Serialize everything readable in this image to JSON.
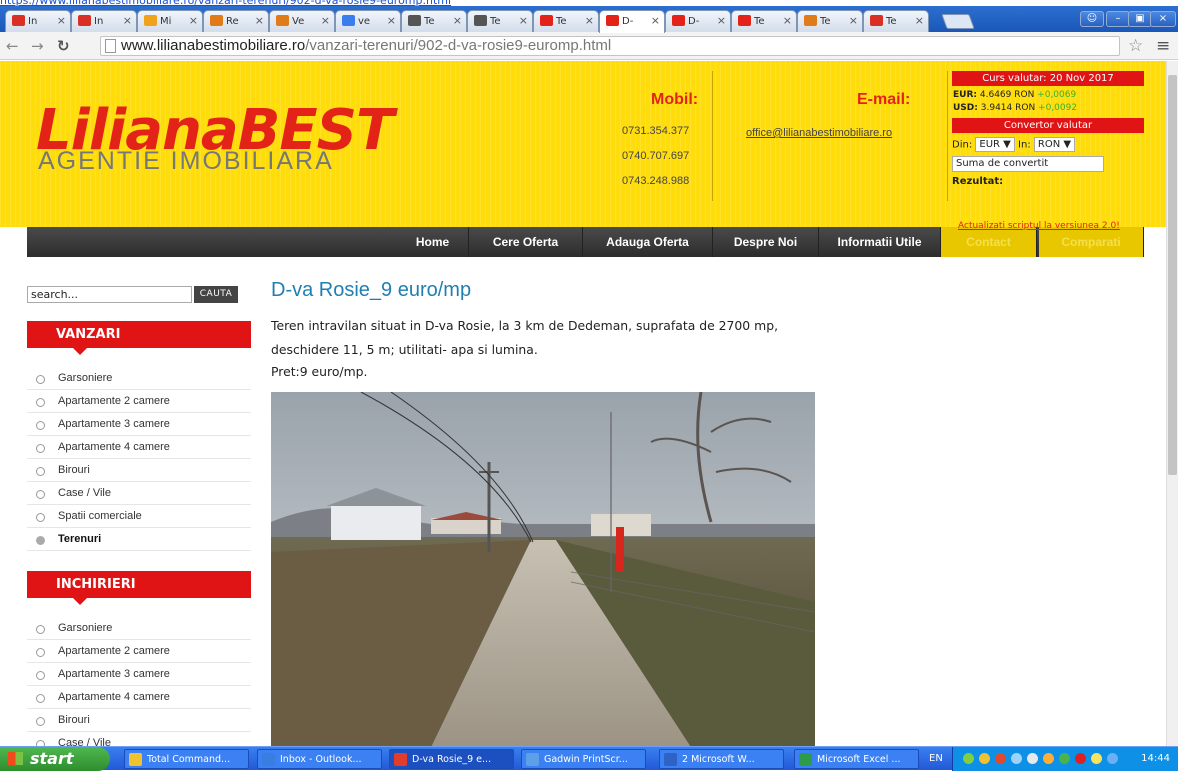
{
  "browser": {
    "tabs": [
      {
        "label": "In",
        "icon": "gmail-icon",
        "color": "#d93025"
      },
      {
        "label": "In",
        "icon": "gmail-icon",
        "color": "#d93025"
      },
      {
        "label": "Mi",
        "icon": "mail-icon",
        "color": "#f0a21a"
      },
      {
        "label": "Re",
        "icon": "olx-icon",
        "color": "#e07b1a"
      },
      {
        "label": "Ve",
        "icon": "olx-icon",
        "color": "#e07b1a"
      },
      {
        "label": "ve",
        "icon": "google-icon",
        "color": "#3b7ded"
      },
      {
        "label": "Te",
        "icon": "key-icon",
        "color": "#555555"
      },
      {
        "label": "Te",
        "icon": "key-icon",
        "color": "#555555"
      },
      {
        "label": "Te",
        "icon": "lb-icon",
        "color": "#e32317"
      },
      {
        "label": "D-",
        "icon": "lb-icon",
        "color": "#e32317"
      },
      {
        "label": "D-",
        "icon": "lb-icon",
        "color": "#e32317"
      },
      {
        "label": "Te",
        "icon": "lb-icon",
        "color": "#e32317"
      },
      {
        "label": "Te",
        "icon": "tabs-icon",
        "color": "#e07b1a"
      },
      {
        "label": "Te",
        "icon": "home-icon",
        "color": "#d93025"
      }
    ],
    "url_domain": "www.lilianabestimobiliare.ro",
    "url_path": "/vanzari-terenuri/902-d-va-rosie9-euromp.html"
  },
  "header": {
    "logo_line1": "LilianaBEST",
    "logo_line2": "AGENTIE IMOBILIARA",
    "mobil_label": "Mobil:",
    "phones": [
      "0731.354.377",
      "0740.707.697",
      "0743.248.988"
    ],
    "email_label": "E-mail:",
    "email": "office@lilianabestimobiliare.ro"
  },
  "currency": {
    "title": "Curs valutar: 20 Nov 2017",
    "eur_label": "EUR:",
    "eur_value": "4.6469 RON",
    "eur_change": "+0,0069",
    "usd_label": "USD:",
    "usd_value": "3.9414 RON",
    "usd_change": "+0,0092",
    "converter_title": "Convertor valutar",
    "from_label": "Din:",
    "from_value": "EUR",
    "to_label": "In:",
    "to_value": "RON",
    "amount_placeholder": "Suma de convertit",
    "result_label": "Rezultat:",
    "update_link": "Actualizati scriptul la versiunea 2.0!"
  },
  "nav": {
    "items": [
      "Home",
      "Cere Oferta",
      "Adauga Oferta",
      "Despre Noi",
      "Informatii Utile",
      "Contact",
      "Comparati"
    ]
  },
  "sidebar": {
    "search_value": "search...",
    "search_button": "CAUTA",
    "sales_title": "VANZARI",
    "sales_items": [
      "Garsoniere",
      "Apartamente 2 camere",
      "Apartamente 3 camere",
      "Apartamente 4 camere",
      "Birouri",
      "Case / Vile",
      "Spatii comerciale",
      "Terenuri"
    ],
    "rent_title": "INCHIRIERI",
    "rent_items": [
      "Garsoniere",
      "Apartamente 2 camere",
      "Apartamente 3 camere",
      "Apartamente 4 camere",
      "Birouri",
      "Case / Vile"
    ]
  },
  "listing": {
    "title": "D-va Rosie_9 euro/mp",
    "description": "Teren intravilan situat in D-va Rosie, la 3 km de Dedeman, suprafata de 2700 mp, deschidere 11, 5 m; utilitati- apa si lumina.",
    "price": "Pret:9 euro/mp."
  },
  "taskbar": {
    "start_label": "start",
    "tasks": [
      "Total Command...",
      "Inbox - Outlook...",
      "D-va Rosie_9 e...",
      "Gadwin PrintScr...",
      "2 Microsoft W...",
      "Microsoft Excel ..."
    ],
    "language": "EN",
    "clock": "14:44"
  }
}
